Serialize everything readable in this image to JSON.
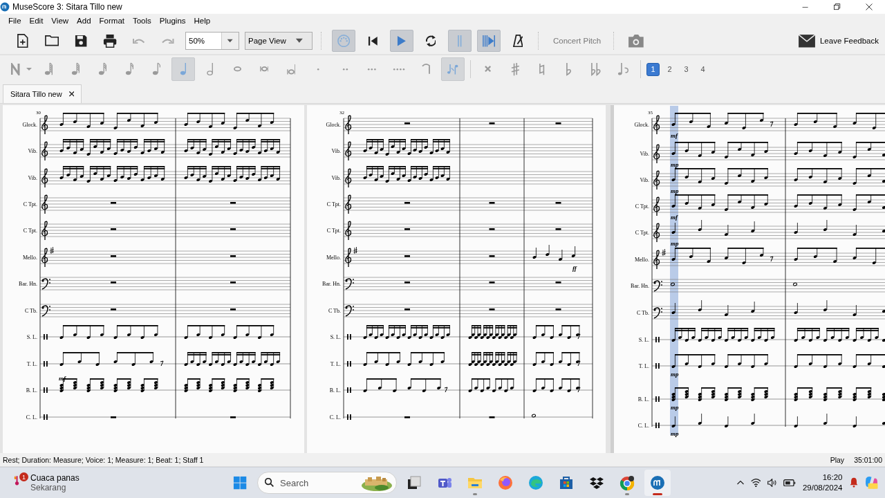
{
  "window": {
    "title": "MuseScore 3: Sitara Tillo new"
  },
  "menu": [
    "File",
    "Edit",
    "View",
    "Add",
    "Format",
    "Tools",
    "Plugins",
    "Help"
  ],
  "toolbar": {
    "file": [
      {
        "kind": "new",
        "disabled": false
      },
      {
        "kind": "open",
        "disabled": false
      },
      {
        "kind": "save",
        "disabled": false
      },
      {
        "kind": "print",
        "disabled": false
      },
      {
        "kind": "undo",
        "disabled": true
      },
      {
        "kind": "redo",
        "disabled": true
      }
    ],
    "zoom": "50%",
    "view_mode": "Page View",
    "playback": [
      {
        "kind": "midi",
        "on": true
      },
      {
        "kind": "rewind",
        "on": false
      },
      {
        "kind": "play",
        "on": true
      },
      {
        "kind": "loop",
        "on": false
      },
      {
        "kind": "loopin",
        "on": true
      },
      {
        "kind": "loopout",
        "on": true
      },
      {
        "kind": "metronome",
        "on": false
      }
    ],
    "concert_pitch": {
      "label": "Concert Pitch",
      "on": false
    },
    "feedback": "Leave Feedback"
  },
  "note_input": {
    "mode_on": false,
    "durations": [
      {
        "kind": "hundredtwentyeighth",
        "selected": false
      },
      {
        "kind": "sixtyfourth",
        "selected": false
      },
      {
        "kind": "thirtysecond",
        "selected": false
      },
      {
        "kind": "sixteenth",
        "selected": false
      },
      {
        "kind": "eighth",
        "selected": false
      },
      {
        "kind": "quarter",
        "selected": true
      },
      {
        "kind": "half",
        "selected": false
      },
      {
        "kind": "whole",
        "selected": false
      },
      {
        "kind": "breve",
        "selected": false
      },
      {
        "kind": "longa",
        "selected": false
      }
    ],
    "tools": [
      {
        "kind": "dot",
        "on": false
      },
      {
        "kind": "doubledot",
        "on": false
      },
      {
        "kind": "tripledot",
        "on": false
      },
      {
        "kind": "quaddot",
        "on": false
      },
      {
        "kind": "tie",
        "on": false
      },
      {
        "kind": "flip",
        "on": true
      }
    ],
    "accidentals": [
      {
        "kind": "doublesharp"
      },
      {
        "kind": "sharp"
      },
      {
        "kind": "natural"
      },
      {
        "kind": "flat"
      },
      {
        "kind": "doubleflat"
      },
      {
        "kind": "respell"
      }
    ],
    "voices": [
      {
        "label": "1",
        "selected": true
      },
      {
        "label": "2",
        "selected": false
      },
      {
        "label": "3",
        "selected": false
      },
      {
        "label": "4",
        "selected": false
      }
    ]
  },
  "tabs": [
    {
      "label": "Sitara Tillo new",
      "selected": true
    }
  ],
  "score": {
    "systems": [
      {
        "measure_number": "30",
        "staves": [
          {
            "label": "Glock.",
            "kind": "treble",
            "measures": [
              {
                "kind": "eighths"
              },
              {
                "kind": "eighths"
              }
            ]
          },
          {
            "label": "Vib.",
            "kind": "treble",
            "measures": [
              {
                "kind": "sixteenths"
              },
              {
                "kind": "sixteenths"
              }
            ]
          },
          {
            "label": "Vib.",
            "kind": "treble",
            "measures": [
              {
                "kind": "sixteenths"
              },
              {
                "kind": "sixteenths"
              }
            ]
          },
          {
            "label": "C Tpt.",
            "kind": "treble",
            "measures": [
              {
                "kind": "rest"
              },
              {
                "kind": "rest"
              }
            ]
          },
          {
            "label": "C Tpt.",
            "kind": "treble",
            "measures": [
              {
                "kind": "rest"
              },
              {
                "kind": "rest"
              }
            ]
          },
          {
            "label": "Mello.",
            "kind": "treblesharp",
            "measures": [
              {
                "kind": "rest"
              },
              {
                "kind": "rest"
              }
            ]
          },
          {
            "label": "Bar. Hn.",
            "kind": "bass",
            "measures": [
              {
                "kind": "rest"
              },
              {
                "kind": "rest"
              }
            ]
          },
          {
            "label": "C Tb.",
            "kind": "bass",
            "measures": [
              {
                "kind": "rest"
              },
              {
                "kind": "rest"
              }
            ]
          },
          {
            "label": "S. L.",
            "kind": "percussion",
            "measures": [
              {
                "kind": "eighths"
              },
              {
                "kind": "eighths"
              }
            ]
          },
          {
            "label": "T. L.",
            "kind": "percussion",
            "measures": [
              {
                "kind": "mixed"
              },
              {
                "kind": "sixteenths"
              }
            ]
          },
          {
            "label": "B. L.",
            "kind": "percussion",
            "dynamic": {
              "text": "mf",
              "kind": "above"
            },
            "measures": [
              {
                "kind": "chords"
              },
              {
                "kind": "chords"
              }
            ]
          },
          {
            "label": "C. L.",
            "kind": "percussion",
            "measures": [
              {
                "kind": "rest"
              },
              {
                "kind": "rest"
              }
            ]
          }
        ]
      },
      {
        "measure_number": "32",
        "staves": [
          {
            "label": "Glock.",
            "kind": "treble",
            "measures": [
              {
                "kind": "rest"
              },
              {
                "kind": "rest"
              },
              {
                "kind": "rest"
              }
            ]
          },
          {
            "label": "Vib.",
            "kind": "treble",
            "measures": [
              {
                "kind": "sixteenths"
              },
              {
                "kind": "empty"
              },
              {
                "kind": "empty"
              }
            ]
          },
          {
            "label": "Vib.",
            "kind": "treble",
            "measures": [
              {
                "kind": "sixteenths"
              },
              {
                "kind": "empty"
              },
              {
                "kind": "empty"
              }
            ]
          },
          {
            "label": "C Tpt.",
            "kind": "treble",
            "measures": [
              {
                "kind": "rest"
              },
              {
                "kind": "rest"
              },
              {
                "kind": "rest"
              }
            ]
          },
          {
            "label": "C Tpt.",
            "kind": "treble",
            "measures": [
              {
                "kind": "rest"
              },
              {
                "kind": "rest"
              },
              {
                "kind": "rest"
              }
            ]
          },
          {
            "label": "Mello.",
            "kind": "treblesharp",
            "dynamic": {
              "text": "ff",
              "kind": "below"
            },
            "measures": [
              {
                "kind": "rest"
              },
              {
                "kind": "rest"
              },
              {
                "kind": "quarters"
              }
            ]
          },
          {
            "label": "Bar. Hn.",
            "kind": "bass",
            "measures": [
              {
                "kind": "rest"
              },
              {
                "kind": "rest"
              },
              {
                "kind": "rest"
              }
            ]
          },
          {
            "label": "C Tb.",
            "kind": "bass",
            "measures": [
              {
                "kind": "rest"
              },
              {
                "kind": "rest"
              },
              {
                "kind": "rest"
              }
            ]
          },
          {
            "label": "S. L.",
            "kind": "percussion",
            "measures": [
              {
                "kind": "sixteenths"
              },
              {
                "kind": "sixteenths"
              },
              {
                "kind": "mixed"
              }
            ]
          },
          {
            "label": "T. L.",
            "kind": "percussion",
            "measures": [
              {
                "kind": "eighths"
              },
              {
                "kind": "sixteenths"
              },
              {
                "kind": "mixed"
              }
            ]
          },
          {
            "label": "B. L.",
            "kind": "percussion",
            "measures": [
              {
                "kind": "mixed"
              },
              {
                "kind": "eighths"
              },
              {
                "kind": "mixed"
              }
            ]
          },
          {
            "label": "C. L.",
            "kind": "percussion",
            "measures": [
              {
                "kind": "rest"
              },
              {
                "kind": "rest"
              },
              {
                "kind": "whole"
              }
            ]
          }
        ]
      },
      {
        "measure_number": "35",
        "selection_highlight": true,
        "staves": [
          {
            "label": "Glock.",
            "kind": "treble",
            "dynamic": {
              "text": "mf",
              "kind": "below"
            },
            "measures": [
              {
                "kind": "mixed"
              },
              {
                "kind": "mixed"
              }
            ]
          },
          {
            "label": "Vib.",
            "kind": "treble",
            "dynamic": {
              "text": "mp",
              "kind": "below"
            },
            "measures": [
              {
                "kind": "eighths"
              },
              {
                "kind": "eighths"
              }
            ]
          },
          {
            "label": "Vib.",
            "kind": "treble",
            "dynamic": {
              "text": "mp",
              "kind": "below"
            },
            "measures": [
              {
                "kind": "eighths"
              },
              {
                "kind": "eighths"
              }
            ]
          },
          {
            "label": "C Tpt.",
            "kind": "treble",
            "dynamic": {
              "text": "mf",
              "kind": "below"
            },
            "measures": [
              {
                "kind": "eighths"
              },
              {
                "kind": "eighths"
              }
            ]
          },
          {
            "label": "C Tpt.",
            "kind": "treble",
            "dynamic": {
              "text": "mp",
              "kind": "below"
            },
            "measures": [
              {
                "kind": "quarters"
              },
              {
                "kind": "quarters"
              }
            ]
          },
          {
            "label": "Mello.",
            "kind": "treblesharp",
            "measures": [
              {
                "kind": "mixed"
              },
              {
                "kind": "mixed"
              }
            ]
          },
          {
            "label": "Bar. Hn.",
            "kind": "bass",
            "measures": [
              {
                "kind": "whole"
              },
              {
                "kind": "whole"
              }
            ]
          },
          {
            "label": "C Tb.",
            "kind": "bass",
            "measures": [
              {
                "kind": "quarters"
              },
              {
                "kind": "quarters"
              }
            ]
          },
          {
            "label": "S. L.",
            "kind": "percussion",
            "measures": [
              {
                "kind": "sixteenths"
              },
              {
                "kind": "sixteenths"
              }
            ]
          },
          {
            "label": "T. L.",
            "kind": "percussion",
            "dynamic": {
              "text": "mp",
              "kind": "below"
            },
            "measures": [
              {
                "kind": "eighths"
              },
              {
                "kind": "eighths"
              }
            ]
          },
          {
            "label": "B. L.",
            "kind": "percussion",
            "dynamic": {
              "text": "mp",
              "kind": "below"
            },
            "measures": [
              {
                "kind": "chords"
              },
              {
                "kind": "chords"
              }
            ]
          },
          {
            "label": "C. L.",
            "kind": "percussion",
            "dynamic": {
              "text": "mp",
              "kind": "below"
            },
            "measures": [
              {
                "kind": "quarters"
              },
              {
                "kind": "quarters"
              }
            ]
          }
        ]
      }
    ]
  },
  "status_bar": {
    "text": "Rest; Duration: Measure; Voice: 1;  Measure: 1; Beat: 1; Staff 1",
    "mode": "Play",
    "time": "35:01:00"
  },
  "taskbar": {
    "weather": {
      "title": "Cuaca panas",
      "subtitle": "Sekarang",
      "badge": "1"
    },
    "search": {
      "placeholder": "Search"
    },
    "apps": [
      {
        "kind": "taskview",
        "running": false,
        "active": false
      },
      {
        "kind": "teams",
        "running": false,
        "active": false
      },
      {
        "kind": "explorer",
        "running": true,
        "active": false
      },
      {
        "kind": "firefox",
        "running": false,
        "active": false
      },
      {
        "kind": "edge",
        "running": false,
        "active": false
      },
      {
        "kind": "store",
        "running": false,
        "active": false
      },
      {
        "kind": "dropbox",
        "running": false,
        "active": false
      },
      {
        "kind": "chrome",
        "running": true,
        "active": false
      },
      {
        "kind": "musescore",
        "running": true,
        "active": true
      }
    ],
    "time": "16:20",
    "date": "29/08/2024"
  }
}
